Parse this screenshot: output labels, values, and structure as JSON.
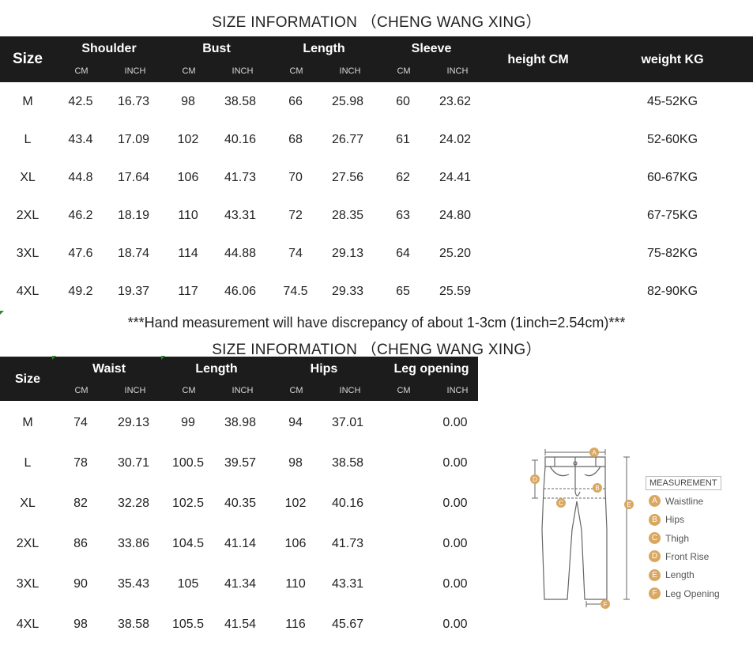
{
  "top": {
    "title": "SIZE INFORMATION （CHENG WANG XING）",
    "header": {
      "size": "Size",
      "groups": [
        "Shoulder",
        "Bust",
        "Length",
        "Sleeve"
      ],
      "cm": "CM",
      "inch": "INCH",
      "height": "height  CM",
      "weight": "weight  KG"
    },
    "rows": [
      {
        "size": "M",
        "vals": [
          "42.5",
          "16.73",
          "98",
          "38.58",
          "66",
          "25.98",
          "60",
          "23.62"
        ],
        "weight": "45-52KG"
      },
      {
        "size": "L",
        "vals": [
          "43.4",
          "17.09",
          "102",
          "40.16",
          "68",
          "26.77",
          "61",
          "24.02"
        ],
        "weight": "52-60KG"
      },
      {
        "size": "XL",
        "vals": [
          "44.8",
          "17.64",
          "106",
          "41.73",
          "70",
          "27.56",
          "62",
          "24.41"
        ],
        "weight": "60-67KG"
      },
      {
        "size": "2XL",
        "vals": [
          "46.2",
          "18.19",
          "110",
          "43.31",
          "72",
          "28.35",
          "63",
          "24.80"
        ],
        "weight": "67-75KG"
      },
      {
        "size": "3XL",
        "vals": [
          "47.6",
          "18.74",
          "114",
          "44.88",
          "74",
          "29.13",
          "64",
          "25.20"
        ],
        "weight": "75-82KG"
      },
      {
        "size": "4XL",
        "vals": [
          "49.2",
          "19.37",
          "117",
          "46.06",
          "74.5",
          "29.33",
          "65",
          "25.59"
        ],
        "weight": "82-90KG"
      }
    ]
  },
  "note": "***Hand measurement will have discrepancy of about 1-3cm (1inch=2.54cm)***",
  "bottom": {
    "title": "SIZE INFORMATION （CHENG WANG XING）",
    "header": {
      "size": "Size",
      "groups": [
        "Waist",
        "Length",
        "Hips",
        "Leg opening"
      ],
      "cm": "CM",
      "inch": "INCH"
    },
    "rows": [
      {
        "size": "M",
        "vals": [
          "74",
          "29.13",
          "99",
          "38.98",
          "94",
          "37.01"
        ],
        "leg": "0.00"
      },
      {
        "size": "L",
        "vals": [
          "78",
          "30.71",
          "100.5",
          "39.57",
          "98",
          "38.58"
        ],
        "leg": "0.00"
      },
      {
        "size": "XL",
        "vals": [
          "82",
          "32.28",
          "102.5",
          "40.35",
          "102",
          "40.16"
        ],
        "leg": "0.00"
      },
      {
        "size": "2XL",
        "vals": [
          "86",
          "33.86",
          "104.5",
          "41.14",
          "106",
          "41.73"
        ],
        "leg": "0.00"
      },
      {
        "size": "3XL",
        "vals": [
          "90",
          "35.43",
          "105",
          "41.34",
          "110",
          "43.31"
        ],
        "leg": "0.00"
      },
      {
        "size": "4XL",
        "vals": [
          "98",
          "38.58",
          "105.5",
          "41.54",
          "116",
          "45.67"
        ],
        "leg": "0.00"
      }
    ]
  },
  "measurement": {
    "title": "MEASUREMENT",
    "items": [
      {
        "letter": "A",
        "label": "Waistline"
      },
      {
        "letter": "B",
        "label": "Hips"
      },
      {
        "letter": "C",
        "label": "Thigh"
      },
      {
        "letter": "D",
        "label": "Front Rise"
      },
      {
        "letter": "E",
        "label": "Length"
      },
      {
        "letter": "F",
        "label": "Leg Opening"
      }
    ],
    "badge_color": "#d9a760"
  }
}
